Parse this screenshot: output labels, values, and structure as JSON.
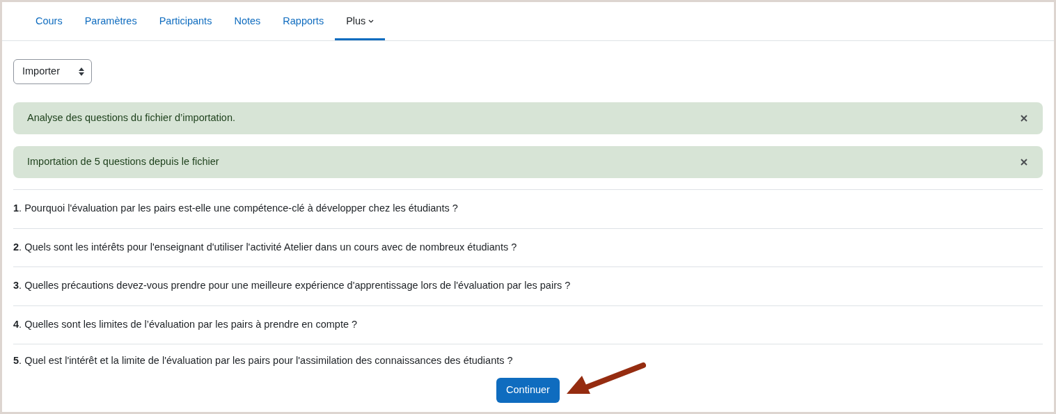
{
  "tabs": [
    {
      "label": "Cours",
      "selected": false,
      "has_caret": false
    },
    {
      "label": "Paramètres",
      "selected": false,
      "has_caret": false
    },
    {
      "label": "Participants",
      "selected": false,
      "has_caret": false
    },
    {
      "label": "Notes",
      "selected": false,
      "has_caret": false
    },
    {
      "label": "Rapports",
      "selected": false,
      "has_caret": false
    },
    {
      "label": "Plus",
      "selected": true,
      "has_caret": true
    }
  ],
  "action_select": {
    "value": "Importer"
  },
  "alerts": [
    {
      "text": "Analyse des questions du fichier d’importation."
    },
    {
      "text": "Importation de 5 questions depuis le fichier"
    }
  ],
  "questions": [
    "**1**. Pourquoi l'évaluation par les pairs est-elle une compétence-clé à développer chez les étudiants ?",
    "**2**. Quels sont les intérêts pour l'enseignant d'utiliser l'activité Atelier dans un cours avec de nombreux étudiants ?",
    "**3**. Quelles précautions devez-vous prendre pour une meilleure expérience d'apprentissage lors de l'évaluation par les pairs ?",
    "**4**. Quelles sont les limites de l’évaluation par les pairs à prendre en compte ?",
    "**5**. Quel est l'intérêt et la limite de l'évaluation par les pairs pour l'assimilation des connaissances des étudiants ?"
  ],
  "continue_button": "Continuer"
}
